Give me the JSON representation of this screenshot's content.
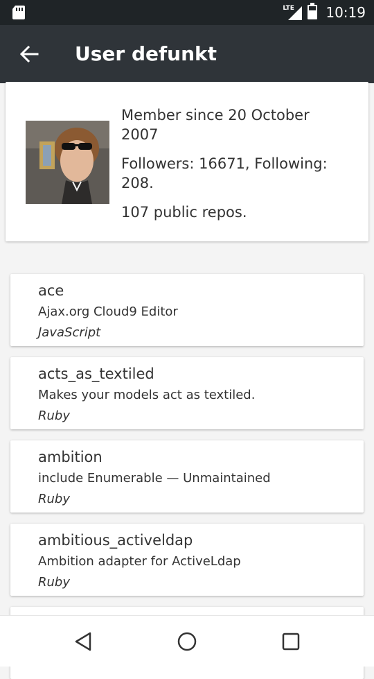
{
  "status_bar": {
    "network": "LTE",
    "time": "10:19",
    "icons": [
      "sd-card-icon",
      "signal-icon",
      "battery-icon"
    ]
  },
  "app_bar": {
    "title": "User defunkt",
    "back_icon": "back-arrow-icon"
  },
  "profile": {
    "member_since": "Member since 20 October 2007",
    "follow_stats": "Followers: 16671, Following: 208.",
    "public_repos": "107 public repos."
  },
  "repos": [
    {
      "name": "ace",
      "description": "Ajax.org Cloud9 Editor",
      "language": "JavaScript"
    },
    {
      "name": "acts_as_textiled",
      "description": "Makes your models act as textiled.",
      "language": "Ruby"
    },
    {
      "name": "ambition",
      "description": "include Enumerable — Unmaintained",
      "language": "Ruby"
    },
    {
      "name": "ambitious_activeldap",
      "description": "Ambition adapter for ActiveLdap",
      "language": "Ruby"
    }
  ],
  "nav_bar": {
    "icons": [
      "back-triangle-icon",
      "home-circle-icon",
      "recents-square-icon"
    ]
  }
}
